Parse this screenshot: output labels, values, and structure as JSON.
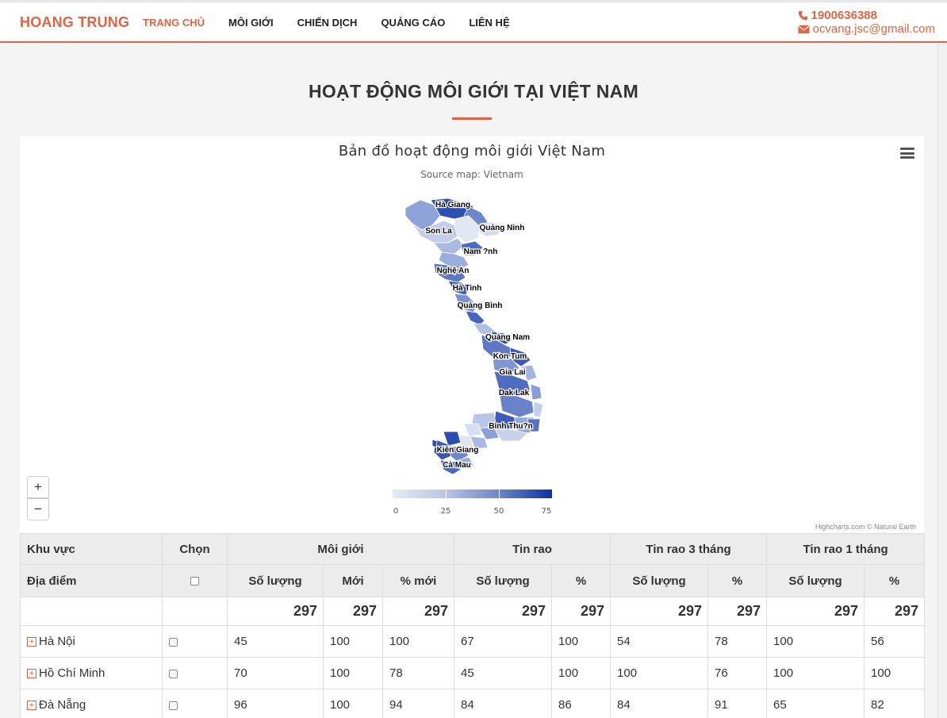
{
  "header": {
    "brand": "HOANG TRUNG",
    "nav": [
      "TRANG CHỦ",
      "MÔI GIỚI",
      "CHIẾN DỊCH",
      "QUẢNG CÁO",
      "LIÊN HỆ"
    ],
    "phone": "1900636388",
    "email": "ocvang.jsc@gmail.com",
    "phone_icon": "phone-icon",
    "email_icon": "envelope-icon",
    "accent_color": "#e2633f"
  },
  "section": {
    "title": "HOẠT ĐỘNG MÔI GIỚI TẠI VIỆT NAM"
  },
  "map": {
    "title": "Bản đồ hoạt động môi giới Việt Nam",
    "subtitle": "Source map: Vietnam",
    "zoom_in": "+",
    "zoom_out": "−",
    "legend": [
      "0",
      "25",
      "50",
      "75"
    ],
    "credits": "Highcharts.com © Natural Earth",
    "labels": [
      "Hà Giang",
      "Quảng Ninh",
      "Son La",
      "Nam ?nh",
      "Nghệ An",
      "Hà Tinh",
      "Quảng Bình",
      "Quảng Nam",
      "Kon Tum",
      "Gia Lai",
      "Dak Lak",
      "Bình Thu?n",
      "Kiên Giang",
      "Cà Mau"
    ],
    "colors": {
      "low": "#e6ebf5",
      "high": "#0a34a3"
    }
  },
  "table": {
    "head1": [
      "Khu vực",
      "Chọn",
      "Môi giới",
      "Tin rao",
      "Tin rao 3 tháng",
      "Tin rao 1 tháng"
    ],
    "head2": [
      "Địa điểm",
      "Số lượng",
      "Mới",
      "% mới",
      "Số lượng",
      "%",
      "Số lượng",
      "%",
      "Số lượng",
      "%"
    ],
    "totals": [
      "297",
      "297",
      "297",
      "297",
      "297",
      "297",
      "297",
      "297",
      "297"
    ],
    "rows": [
      {
        "name": "Hà Nội",
        "values": [
          "45",
          "100",
          "100",
          "67",
          "100",
          "54",
          "78",
          "100",
          "56"
        ]
      },
      {
        "name": "Hồ Chí Minh",
        "values": [
          "70",
          "100",
          "78",
          "45",
          "100",
          "100",
          "76",
          "100",
          "100"
        ]
      },
      {
        "name": "Đà Nẵng",
        "values": [
          "96",
          "100",
          "94",
          "84",
          "86",
          "84",
          "91",
          "65",
          "82"
        ]
      }
    ]
  }
}
